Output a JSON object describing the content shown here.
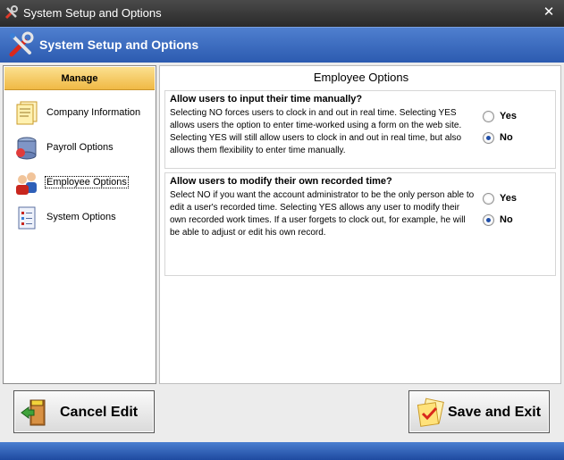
{
  "window": {
    "title": "System Setup and Options",
    "close_glyph": "✕"
  },
  "header": {
    "title": "System Setup and Options"
  },
  "sidebar": {
    "heading": "Manage",
    "items": [
      {
        "label": "Company Information",
        "icon": "company-info-icon"
      },
      {
        "label": "Payroll Options",
        "icon": "payroll-icon"
      },
      {
        "label": "Employee Options",
        "icon": "employee-icon",
        "selected": true
      },
      {
        "label": "System Options",
        "icon": "system-options-icon"
      }
    ]
  },
  "main": {
    "title": "Employee Options",
    "groups": [
      {
        "question": "Allow users to input their time manually?",
        "description": "Selecting NO forces users to clock in and out in real time. Selecting YES allows users the option to enter time-worked using a form on the web site. Selecting YES will still allow users to clock in and out in real time, but also allows them flexibility to enter time manually.",
        "yes_label": "Yes",
        "no_label": "No",
        "selected": "No"
      },
      {
        "question": "Allow users to modify their own recorded time?",
        "description": "Select NO if you want the account administrator to be the only person able to edit a user's recorded time. Selecting YES allows any user to modify their own recorded work times. If a user forgets to clock out, for example, he will be able to adjust or edit his own record.",
        "yes_label": "Yes",
        "no_label": "No",
        "selected": "No"
      }
    ]
  },
  "buttons": {
    "cancel_label": "Cancel Edit",
    "save_label": "Save and Exit"
  },
  "colors": {
    "header_blue": "#2c5bb0",
    "manage_gold": "#f0b945",
    "radio_dot": "#1f4ea8"
  }
}
